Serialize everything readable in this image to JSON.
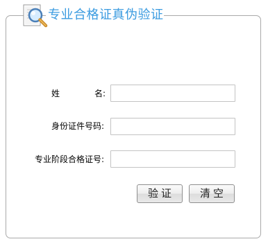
{
  "header": {
    "title": "专业合格证真伪验证",
    "icon": "magnifier-document-icon"
  },
  "form": {
    "name_label_part1": "姓",
    "name_label_part2": "名:",
    "id_label": "身份证件号码:",
    "cert_label": "专业阶段合格证号:",
    "name_value": "",
    "id_value": "",
    "cert_value": ""
  },
  "buttons": {
    "verify_label": "验证",
    "clear_label": "清空"
  },
  "colors": {
    "title": "#3a9be0",
    "panel_border": "#a9a9a9",
    "input_border": "#c3c3c3"
  }
}
